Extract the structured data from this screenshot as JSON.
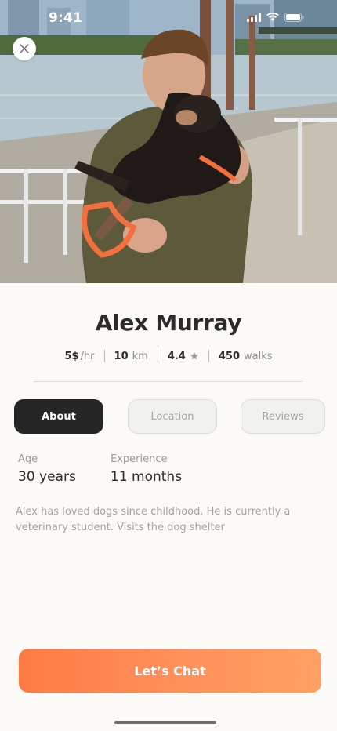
{
  "status_bar": {
    "time": "9:41"
  },
  "hero": {
    "photo_subject": "man-holding-dog-photo"
  },
  "profile": {
    "name": "Alex Murray",
    "stats": {
      "price_value": "5$",
      "price_unit": "/hr",
      "distance_value": "10",
      "distance_unit": "km",
      "rating_value": "4.4",
      "walks_value": "450",
      "walks_unit": "walks"
    }
  },
  "tabs": [
    {
      "label": "About",
      "active": true
    },
    {
      "label": "Location",
      "active": false
    },
    {
      "label": "Reviews",
      "active": false
    }
  ],
  "about": {
    "age_label": "Age",
    "age_value": "30 years",
    "experience_label": "Experience",
    "experience_value": "11 months",
    "bio": "Alex has loved dogs since childhood. He is currently a veterinary student. Visits the dog shelter"
  },
  "cta": {
    "label": "Let’s Chat"
  },
  "colors": {
    "accent_start": "#ff7a45",
    "accent_end": "#ffa064",
    "active_tab": "#262626",
    "background": "#fbfaf6"
  }
}
